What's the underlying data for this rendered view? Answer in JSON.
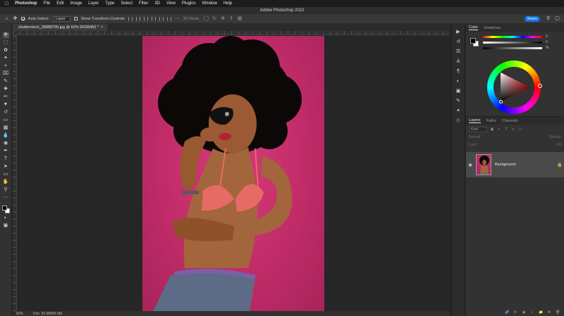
{
  "menubar": {
    "apple": "",
    "app": "Photoshop",
    "items": [
      "File",
      "Edit",
      "Image",
      "Layer",
      "Type",
      "Select",
      "Filter",
      "3D",
      "View",
      "Plugins",
      "Window",
      "Help"
    ]
  },
  "window": {
    "title": "Adobe Photoshop 2022"
  },
  "options": {
    "auto_select_label": "Auto-Select:",
    "auto_select_value": "Layer",
    "transform_label": "Show Transform Controls",
    "mode3d_label": "3D Mode:",
    "share_label": "Share"
  },
  "document": {
    "tab_title": "shutterstock_28888795.jpg @ 62% (RGB/8#) *",
    "zoom": "62%",
    "doc_size": "Doc: 55.9M/55.9M"
  },
  "color_panel": {
    "tabs": [
      "Color",
      "Swatches"
    ],
    "active_tab": "Color",
    "slider_values": [
      "0",
      "0",
      "%"
    ]
  },
  "layers_panel": {
    "tabs": [
      "Layers",
      "Paths",
      "Channels"
    ],
    "active_tab": "Layers",
    "filter_placeholder": "Kind",
    "blend_mode": "Normal",
    "opacity_label": "Opacity:",
    "lock_label": "Lock:",
    "fill_label": "Fill:",
    "layer_name": "Background"
  },
  "colors": {
    "accent": "#1473e6",
    "backdrop": "#c12c68",
    "panel": "#323232",
    "canvas": "#262626"
  },
  "icons": {
    "tools": [
      "move-icon",
      "marquee-icon",
      "lasso-icon",
      "quick-select-icon",
      "crop-icon",
      "frame-icon",
      "eyedropper-icon",
      "healing-icon",
      "brush-icon",
      "stamp-icon",
      "history-brush-icon",
      "eraser-icon",
      "gradient-icon",
      "blur-icon",
      "dodge-icon",
      "pen-icon",
      "type-icon",
      "path-select-icon",
      "rectangle-icon",
      "hand-icon",
      "zoom-icon"
    ]
  }
}
